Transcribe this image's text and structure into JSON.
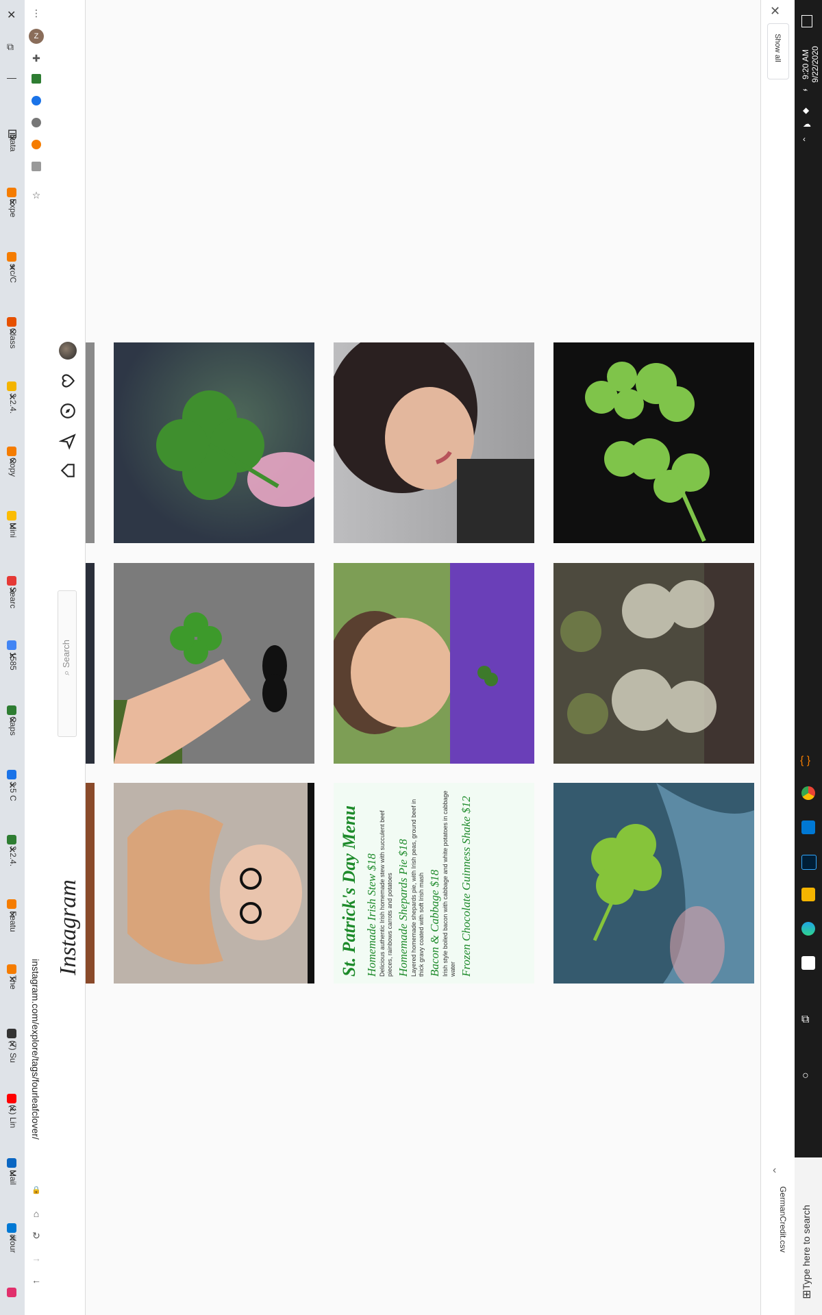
{
  "browser": {
    "tabs": [
      {
        "label": "#four",
        "color": "#e1306c"
      },
      {
        "label": "Mail",
        "color": "#0078d4"
      },
      {
        "label": "(1) Lin",
        "color": "#0a66c2"
      },
      {
        "label": "(7) Su",
        "color": "#ff0000"
      },
      {
        "label": "The",
        "color": "#333333"
      },
      {
        "label": "Featu",
        "color": "#f57c00"
      },
      {
        "label": "3.2.4.",
        "color": "#f57c00"
      },
      {
        "label": "3.5 C",
        "color": "#2e7d32"
      },
      {
        "label": "Caps",
        "color": "#1a73e8"
      },
      {
        "label": "1585",
        "color": "#2e7d32"
      },
      {
        "label": "Searc",
        "color": "#4285f4"
      },
      {
        "label": "Mini",
        "color": "#e53935"
      },
      {
        "label": "Copy",
        "color": "#fbbc04"
      },
      {
        "label": "3.2.4.",
        "color": "#f57c00"
      },
      {
        "label": "Class",
        "color": "#f4b400"
      },
      {
        "label": "src/C",
        "color": "#e65100"
      },
      {
        "label": "Expe",
        "color": "#f57c00"
      },
      {
        "label": "Data",
        "color": "#f57c00"
      }
    ],
    "address_url": "instagram.com/explore/tags/fourleafclover/",
    "icons": {
      "back": "←",
      "forward": "→",
      "reload": "↻",
      "home": "⌂",
      "menu": "⋮",
      "star": "☆",
      "puzzle": "✚",
      "profile_initial": "Z"
    }
  },
  "instagram": {
    "logo": "Instagram",
    "search_placeholder": "Search"
  },
  "posts": [
    {
      "alt": "four-leaf clover in front of pink tulip",
      "bg": "#3d4c5a",
      "accent": "#3f8f2e"
    },
    {
      "alt": "smiling woman with dark hair",
      "bg": "#b7b6b8",
      "accent": "#2a2a2a"
    },
    {
      "alt": "clovers on black sequins",
      "bg": "#111111",
      "accent": "#7fc44a"
    },
    {
      "alt": "hand holding four-leaf clover",
      "bg": "#7d7d7d",
      "accent": "#3d9a2b"
    },
    {
      "alt": "smiling child in purple shirt",
      "bg": "#7a9a5a",
      "accent": "#6a3fb8"
    },
    {
      "alt": "clover resin pieces",
      "bg": "#5b4f46",
      "accent": "#c9c6a8"
    },
    {
      "alt": "woman with glasses lying down",
      "bg": "#c8b9a9",
      "accent": "#1a1a1a"
    },
    {
      "alt": "St. Patrick's Day menu",
      "bg": "#f2fbf4",
      "accent": "#1d8a2a",
      "menu_title": "St. Patrick's Day Menu",
      "items": [
        {
          "name": "Homemade Irish Stew $18",
          "desc": "Delicious authentic Irish homemade stew with succulent beef pieces, rainbows carrots and potatoes"
        },
        {
          "name": "Homemade Shepards Pie $18",
          "desc": "Layered homemade shepards pie, with Irish peas, ground beef in thick gravy coated with soft Irish mash"
        },
        {
          "name": "Bacon & Cabbage $18",
          "desc": "Irish style boiled bacon with cabbage and white potatoes in cabbage water"
        },
        {
          "name": "Frozen Chocolate Guinness Shake $12",
          "desc": ""
        }
      ]
    },
    {
      "alt": "clover on denim",
      "bg": "#3b6276",
      "accent": "#86c43a"
    }
  ],
  "downloads": {
    "show_all": "Show all",
    "file": "GermanCredit.csv"
  },
  "taskbar": {
    "time": "9:20 AM",
    "date": "9/22/2020",
    "search_placeholder": "Type here to search"
  }
}
